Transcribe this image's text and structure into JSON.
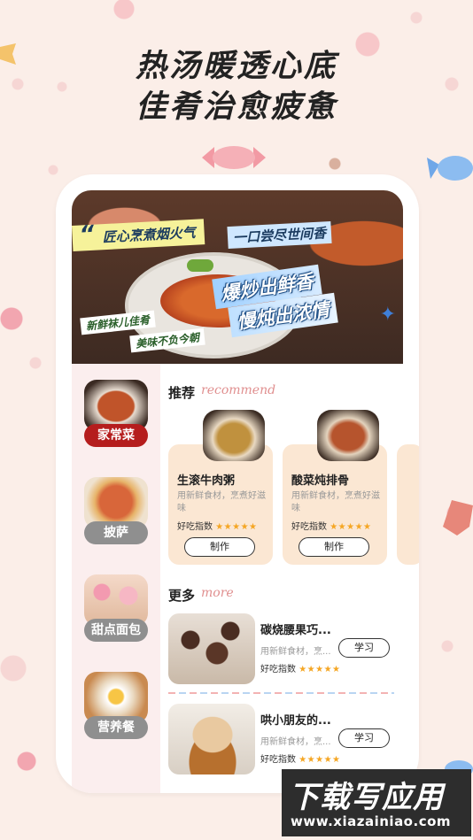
{
  "headline": {
    "line1": "热汤暖透心底",
    "line2": "佳肴治愈疲惫"
  },
  "banner": {
    "quote_mark": "“",
    "tag1": "匠心烹煮烟火气",
    "tag2": "一口尝尽世间香",
    "tag3": "爆炒出鲜香",
    "tag4": "慢炖出浓情",
    "tag5": "新鲜袜儿佳肴",
    "tag6": "美味不负今朝",
    "sparkle": "✦"
  },
  "sidebar": {
    "items": [
      {
        "label": "家常菜",
        "active": true
      },
      {
        "label": "披萨",
        "active": false
      },
      {
        "label": "甜点面包",
        "active": false
      },
      {
        "label": "营养餐",
        "active": false
      }
    ]
  },
  "recommend": {
    "title": "推荐",
    "subtitle": "recommend",
    "cards": [
      {
        "name": "生滚牛肉粥",
        "desc": "用新鲜食材，烹煮好滋味",
        "rating_label": "好吃指数",
        "stars": "★★★★★",
        "button": "制作"
      },
      {
        "name": "酸菜炖排骨",
        "desc": "用新鲜食材，烹煮好滋味",
        "rating_label": "好吃指数",
        "stars": "★★★★★",
        "button": "制作"
      }
    ]
  },
  "more": {
    "title": "更多",
    "subtitle": "more",
    "items": [
      {
        "name": "碳烧腰果巧...",
        "desc": "用新鲜食材，烹...",
        "rating_label": "好吃指数",
        "stars": "★★★★★",
        "button": "学习"
      },
      {
        "name": "哄小朋友的...",
        "desc": "用新鲜食材，烹...",
        "rating_label": "好吃指数",
        "stars": "★★★★★",
        "button": "学习"
      }
    ]
  },
  "watermark": {
    "title": "下载写应用",
    "url": "www.xiazainiao.com"
  }
}
